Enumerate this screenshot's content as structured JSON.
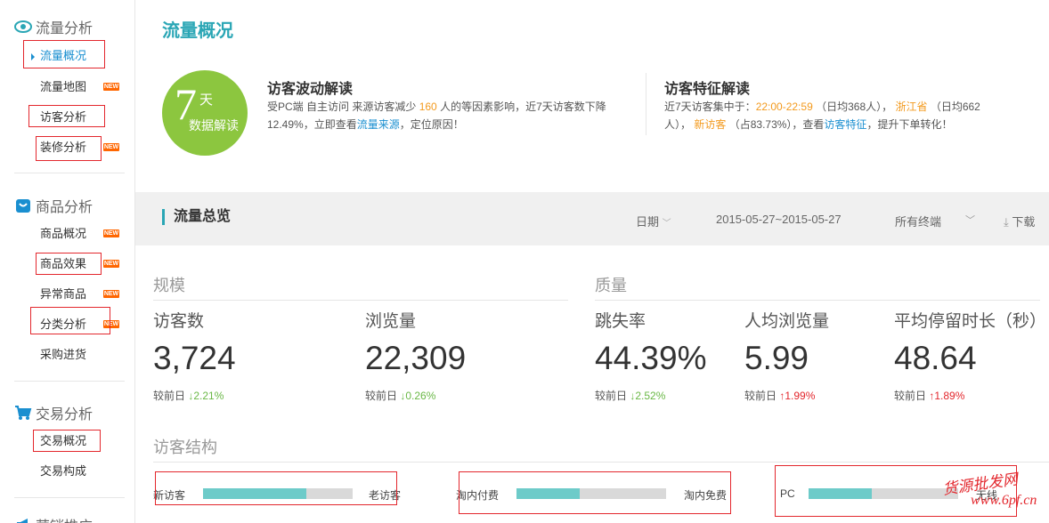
{
  "sidebar": {
    "sections": [
      {
        "title": "流量分析",
        "icon": "eye-icon"
      },
      {
        "title": "商品分析",
        "icon": "bag-icon"
      },
      {
        "title": "交易分析",
        "icon": "cart-icon"
      },
      {
        "title": "营销推广",
        "icon": "megaphone-icon"
      }
    ],
    "traffic_items": [
      "流量概况",
      "流量地图",
      "访客分析",
      "装修分析"
    ],
    "product_items": [
      "商品概况",
      "商品效果",
      "异常商品",
      "分类分析",
      "采购进货"
    ],
    "trade_items": [
      "交易概况",
      "交易构成"
    ],
    "new_badge": "NEW"
  },
  "page": {
    "title": "流量概况"
  },
  "badge": {
    "num": "7",
    "unit": "天",
    "sub": "数据解读"
  },
  "fluctuation": {
    "title": "访客波动解读",
    "text1": "受PC端 自主访问 来源访客减少",
    "count": "160",
    "text2": "人的等因素影响，近7天访客数下降",
    "text3": "12.49%，立即查看",
    "link": "流量来源",
    "text4": "，定位原因！"
  },
  "feature": {
    "title": "访客特征解读",
    "text1": "近7天访客集中于：",
    "time": "22:00-22:59",
    "text2": "（日均368人），",
    "province": "浙江省",
    "text3": "（日均662",
    "text4": "人），",
    "visitor": "新访客",
    "text5": "（占83.73%），查看",
    "link": "访客特征",
    "text6": "，提升下单转化！"
  },
  "overview": {
    "title": "流量总览",
    "date_label": "日期",
    "date_range": "2015-05-27~2015-05-27",
    "terminal": "所有终端",
    "download": "下载"
  },
  "groups": {
    "scale": "规模",
    "quality": "质量"
  },
  "compare_label": "较前日",
  "metrics": [
    {
      "name": "访客数",
      "value": "3,724",
      "change": "2.21%",
      "dir": "down"
    },
    {
      "name": "浏览量",
      "value": "22,309",
      "change": "0.26%",
      "dir": "down"
    },
    {
      "name": "跳失率",
      "value": "44.39%",
      "change": "2.52%",
      "dir": "down"
    },
    {
      "name": "人均浏览量",
      "value": "5.99",
      "change": "1.99%",
      "dir": "up"
    },
    {
      "name": "平均停留时长（秒）",
      "value": "48.64",
      "change": "1.89%",
      "dir": "up"
    }
  ],
  "structure": {
    "title": "访客结构",
    "bars": [
      {
        "left": "新访客",
        "right": "老访客",
        "ratio": 0.69
      },
      {
        "left": "淘内付费",
        "right": "淘内免费",
        "ratio": 0.42
      },
      {
        "left": "PC",
        "right": "无线",
        "ratio": 0.42
      }
    ]
  },
  "watermark": {
    "line1": "货源批发网",
    "line2": "www.6pf.cn"
  }
}
